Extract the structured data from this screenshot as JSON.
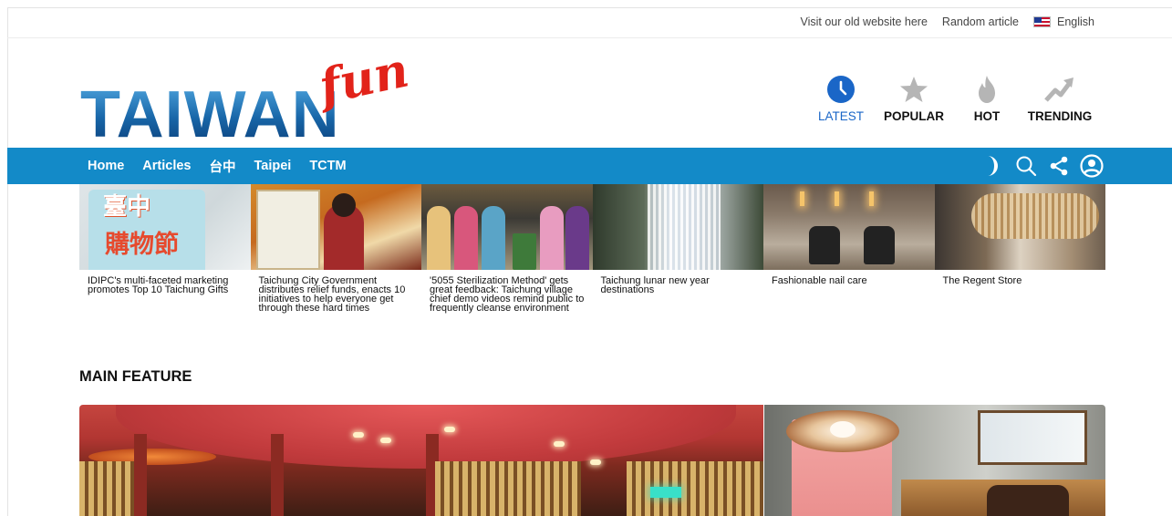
{
  "topbar": {
    "old_site": "Visit our old website here",
    "random": "Random article",
    "language": "English"
  },
  "logo": {
    "main": "TAIWAN",
    "accent": "fun"
  },
  "rank_tabs": [
    {
      "label": "LATEST",
      "icon": "clock-icon",
      "active": true
    },
    {
      "label": "POPULAR",
      "icon": "star-icon",
      "active": false
    },
    {
      "label": "HOT",
      "icon": "flame-icon",
      "active": false
    },
    {
      "label": "TRENDING",
      "icon": "trending-up-icon",
      "active": false
    }
  ],
  "nav": {
    "items": [
      "Home",
      "Articles",
      "台中",
      "Taipei",
      "TCTM"
    ],
    "icons": [
      "moon-icon",
      "search-icon",
      "share-icon",
      "user-icon"
    ]
  },
  "thumbnails": [
    {
      "title": "IDIPC's multi-faceted marketing promotes Top 10 Taichung Gifts"
    },
    {
      "title": "Taichung City Government distributes relief funds, enacts 10 initiatives to help everyone get through these hard times"
    },
    {
      "title": "'5055 Sterilization Method' gets great feedback: Taichung village chief demo videos remind public to frequently cleanse environment"
    },
    {
      "title": "Taichung lunar new year destinations"
    },
    {
      "title": "Fashionable nail care"
    },
    {
      "title": "The Regent Store"
    }
  ],
  "main_feature": {
    "heading": "MAIN FEATURE"
  },
  "colors": {
    "nav_bg": "#138ac8",
    "accent_blue": "#1a66c7",
    "logo_red": "#e2231a"
  }
}
